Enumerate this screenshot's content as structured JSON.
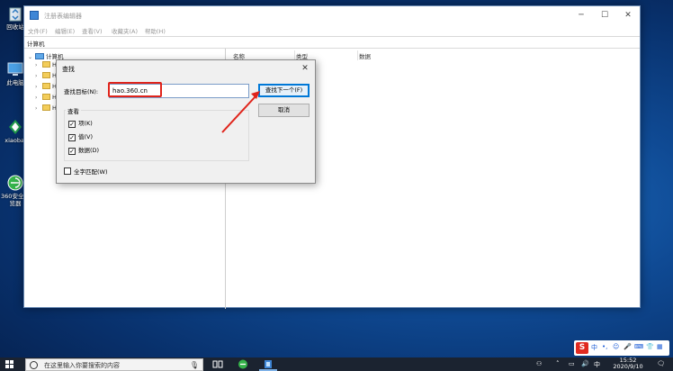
{
  "desktop": {
    "icons": [
      {
        "label": "回收站",
        "icon": "recycle-bin-icon"
      },
      {
        "label": "此电脑",
        "icon": "computer-icon"
      },
      {
        "label": "xiaobai",
        "icon": "xiaobai-icon"
      },
      {
        "label": "360安全浏览器",
        "icon": "360-browser-icon"
      }
    ]
  },
  "window": {
    "title": "注册表编辑器",
    "menu": [
      "文件(F)",
      "编辑(E)",
      "查看(V)",
      "收藏夹(A)",
      "帮助(H)"
    ],
    "address": "计算机",
    "tree": {
      "root": "计算机",
      "children": [
        "H",
        "H",
        "H",
        "H",
        "H"
      ]
    },
    "columns": [
      "名称",
      "类型",
      "数据"
    ]
  },
  "find_dialog": {
    "title": "查找",
    "find_label": "查找目标(N):",
    "find_value": "hao.360.cn",
    "find_next_label": "查找下一个(F)",
    "cancel_label": "取消",
    "group_label": "查看",
    "options": [
      {
        "label": "项(K)",
        "checked": true
      },
      {
        "label": "值(V)",
        "checked": true
      },
      {
        "label": "数据(D)",
        "checked": true
      }
    ],
    "whole_string_label": "全字匹配(W)",
    "whole_string_checked": false
  },
  "annotation": {
    "box_color": "#e0241b",
    "arrow_color": "#e0241b"
  },
  "taskbar": {
    "search_placeholder": "在这里输入你要搜索的内容",
    "ime_mode": "中",
    "clock_time": "15:52",
    "clock_date": "2020/9/10"
  }
}
